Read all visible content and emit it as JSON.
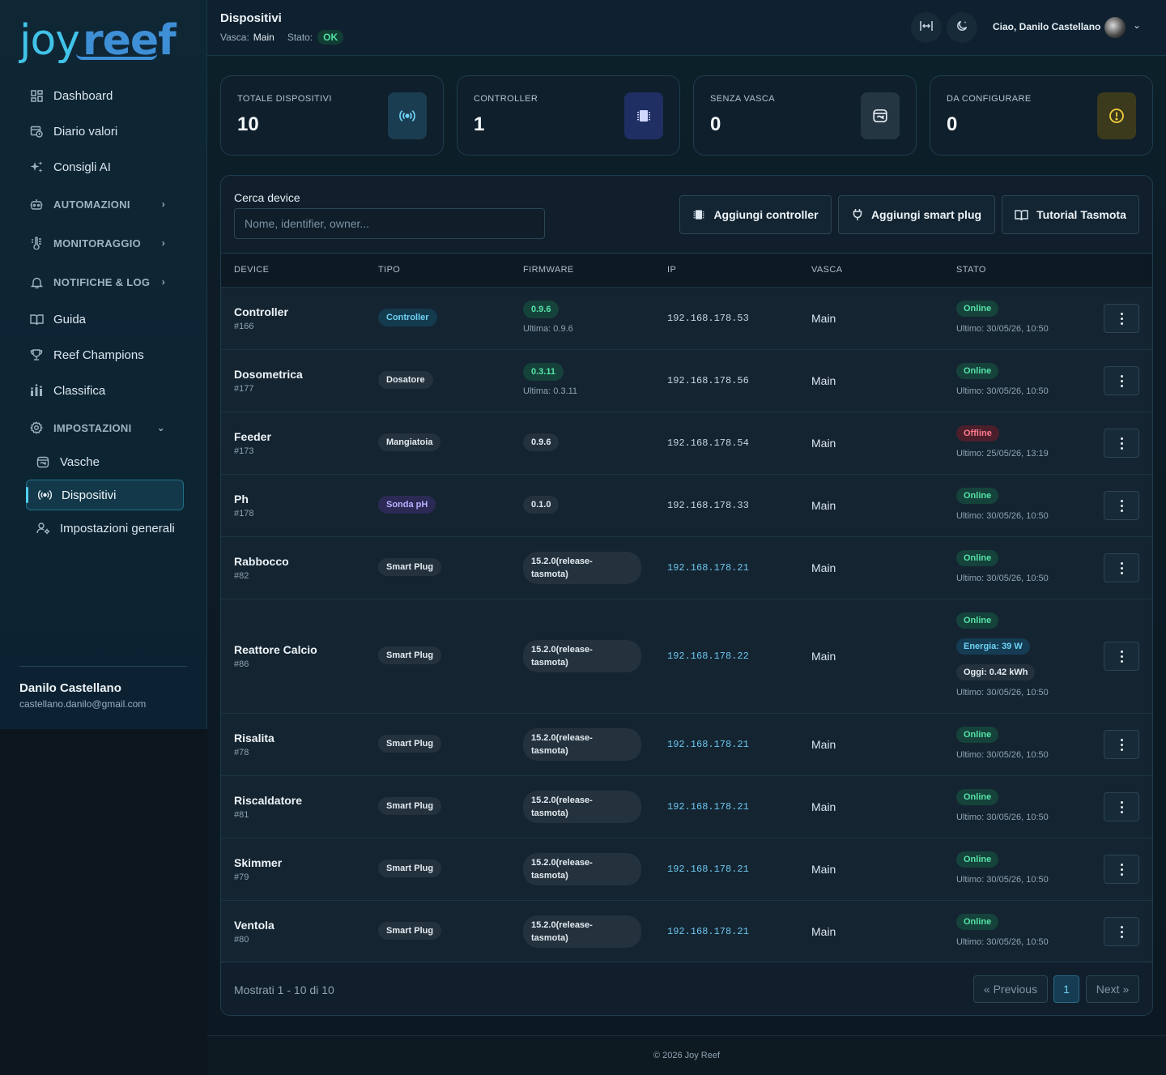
{
  "brand": {
    "joy": "joy",
    "reef": "reef"
  },
  "sidebar": {
    "items": [
      {
        "label": "Dashboard",
        "icon": "dashboard-grid-icon"
      },
      {
        "label": "Diario valori",
        "icon": "calendar-clock-icon"
      },
      {
        "label": "Consigli AI",
        "icon": "sparkles-icon"
      },
      {
        "label": "AUTOMAZIONI",
        "icon": "robot-icon",
        "section": true
      },
      {
        "label": "MONITORAGGIO",
        "icon": "thermometer-icon",
        "section": true
      },
      {
        "label": "NOTIFICHE & LOG",
        "icon": "bell-icon",
        "section": true
      },
      {
        "label": "Guida",
        "icon": "book-icon"
      },
      {
        "label": "Reef Champions",
        "icon": "trophy-icon"
      },
      {
        "label": "Classifica",
        "icon": "leaderboard-icon"
      },
      {
        "label": "IMPOSTAZIONI",
        "icon": "gear-icon",
        "section": true,
        "expanded": true
      }
    ],
    "sub_items": [
      {
        "label": "Vasche",
        "icon": "tank-icon"
      },
      {
        "label": "Dispositivi",
        "icon": "broadcast-icon",
        "active": true
      },
      {
        "label": "Impostazioni generali",
        "icon": "user-gear-icon"
      }
    ],
    "user": {
      "name": "Danilo Castellano",
      "email": "castellano.danilo@gmail.com"
    }
  },
  "header": {
    "title": "Dispositivi",
    "vasca_label": "Vasca:",
    "vasca_value": "Main",
    "stato_label": "Stato:",
    "stato_value": "OK",
    "greeting": "Ciao, Danilo Castellano"
  },
  "stats": [
    {
      "label": "TOTALE DISPOSITIVI",
      "value": "10",
      "icon": "broadcast-icon",
      "color": "#1b3d52",
      "icon_color": "#6ed2f3"
    },
    {
      "label": "CONTROLLER",
      "value": "1",
      "icon": "chip-icon",
      "color": "#1f2f63",
      "icon_color": "#cfd8ff"
    },
    {
      "label": "SENZA VASCA",
      "value": "0",
      "icon": "tank-icon",
      "color": "#243642",
      "icon_color": "#e3ebf1"
    },
    {
      "label": "DA CONFIGURARE",
      "value": "0",
      "icon": "warning-circle-icon",
      "color": "#3c3a1c",
      "icon_color": "#f4d03f"
    }
  ],
  "search": {
    "label": "Cerca device",
    "placeholder": "Nome, identifier, owner..."
  },
  "actions": {
    "add_controller": "Aggiungi controller",
    "add_plug": "Aggiungi smart plug",
    "tutorial": "Tutorial Tasmota"
  },
  "table": {
    "headers": [
      "DEVICE",
      "TIPO",
      "FIRMWARE",
      "IP",
      "VASCA",
      "STATO"
    ],
    "rows": [
      {
        "name": "Controller",
        "id": "#166",
        "tipo": "Controller",
        "fw": "0.9.6",
        "fw_sub": "Ultima: 0.9.6",
        "ip": "192.168.178.53",
        "vasca": "Main",
        "status": "Online",
        "last": "Ultimo: 30/05/26, 10:50"
      },
      {
        "name": "Dosometrica",
        "id": "#177",
        "tipo": "Dosatore",
        "fw": "0.3.11",
        "fw_sub": "Ultima: 0.3.11",
        "ip": "192.168.178.56",
        "vasca": "Main",
        "status": "Online",
        "last": "Ultimo: 30/05/26, 10:50"
      },
      {
        "name": "Feeder",
        "id": "#173",
        "tipo": "Mangiatoia",
        "fw": "0.9.6",
        "ip": "192.168.178.54",
        "vasca": "Main",
        "status": "Offline",
        "last": "Ultimo: 25/05/26, 13:19"
      },
      {
        "name": "Ph",
        "id": "#178",
        "tipo": "Sonda pH",
        "fw": "0.1.0",
        "ip": "192.168.178.33",
        "vasca": "Main",
        "status": "Online",
        "last": "Ultimo: 30/05/26, 10:50"
      },
      {
        "name": "Rabbocco",
        "id": "#82",
        "tipo": "Smart Plug",
        "fw_1": "15.2.0(release-",
        "fw_2": "tasmota)",
        "ip": "192.168.178.21",
        "vasca": "Main",
        "status": "Online",
        "last": "Ultimo: 30/05/26, 10:50"
      },
      {
        "name": "Reattore Calcio",
        "id": "#86",
        "tipo": "Smart Plug",
        "fw_1": "15.2.0(release-",
        "fw_2": "tasmota)",
        "ip": "192.168.178.22",
        "vasca": "Main",
        "status": "Online",
        "energy": "Energia: 39 W",
        "today": "Oggi: 0.42 kWh",
        "last": "Ultimo: 30/05/26, 10:50"
      },
      {
        "name": "Risalita",
        "id": "#78",
        "tipo": "Smart Plug",
        "fw_1": "15.2.0(release-",
        "fw_2": "tasmota)",
        "ip": "192.168.178.21",
        "vasca": "Main",
        "status": "Online",
        "last": "Ultimo: 30/05/26, 10:50"
      },
      {
        "name": "Riscaldatore",
        "id": "#81",
        "tipo": "Smart Plug",
        "fw_1": "15.2.0(release-",
        "fw_2": "tasmota)",
        "ip": "192.168.178.21",
        "vasca": "Main",
        "status": "Online",
        "last": "Ultimo: 30/05/26, 10:50"
      },
      {
        "name": "Skimmer",
        "id": "#79",
        "tipo": "Smart Plug",
        "fw_1": "15.2.0(release-",
        "fw_2": "tasmota)",
        "ip": "192.168.178.21",
        "vasca": "Main",
        "status": "Online",
        "last": "Ultimo: 30/05/26, 10:50"
      },
      {
        "name": "Ventola",
        "id": "#80",
        "tipo": "Smart Plug",
        "fw_1": "15.2.0(release-",
        "fw_2": "tasmota)",
        "ip": "192.168.178.21",
        "vasca": "Main",
        "status": "Online",
        "last": "Ultimo: 30/05/26, 10:50"
      }
    ]
  },
  "pagination": {
    "showing": "Mostrati 1 - 10 di 10",
    "prev": "« Previous",
    "current": "1",
    "next": "Next »"
  },
  "footer": {
    "copyright": "© 2026 Joy Reef"
  }
}
